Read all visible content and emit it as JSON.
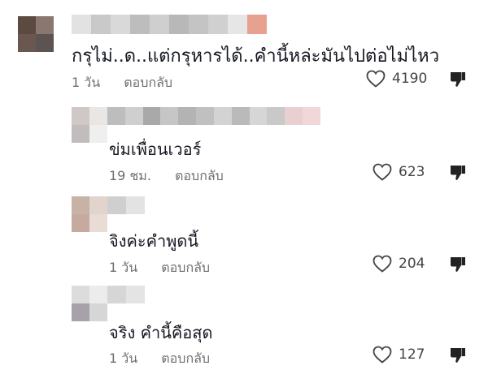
{
  "comments": [
    {
      "text": "กรุไม่..ด..แต่กรุหารได้..คำนี้หล่ะมันไปต่อไม่ไหว",
      "time": "1 วัน",
      "reply_label": "ตอบกลับ",
      "likes": "4190",
      "avatar_colors": [
        "#5a4a40",
        "#8a7870",
        "#6a5850",
        "#5c5452"
      ],
      "username_blocks": [
        "#e2e2e2",
        "#c9c9c9",
        "#d9d9d9",
        "#bdbdbd",
        "#cfcfcf",
        "#b8b8b8",
        "#c4c4c4",
        "#d0d0d0",
        "#e6e6e6",
        "#e8a090"
      ]
    },
    {
      "text": "ข่มเพื่อนเวอร์",
      "time": "19 ชม.",
      "reply_label": "ตอบกลับ",
      "likes": "623",
      "avatar_colors": [
        "#cfc8c6",
        "#e9e6e4",
        "#c2bdbd",
        "#efefef"
      ],
      "username_blocks": [
        "#bdbdbd",
        "#cfcfcf",
        "#a9a9a9",
        "#c6c6c6",
        "#b3b3b3",
        "#c0c0c0",
        "#d3d3d3",
        "#bababa",
        "#d6d6d6",
        "#c9c9c9",
        "#e8d0d0",
        "#f0d8d8"
      ]
    },
    {
      "text": "จิงค่ะคำพูดนี้",
      "time": "1 วัน",
      "reply_label": "ตอบกลับ",
      "likes": "204",
      "avatar_colors": [
        "#c8b2a6",
        "#e0d4cc",
        "#c6aaa0",
        "#e8dcd4"
      ],
      "username_blocks": [
        "#cfcfcf",
        "#e3e3e3"
      ]
    },
    {
      "text": "จริง คำนี้คือสุด",
      "time": "1 วัน",
      "reply_label": "ตอบกลับ",
      "likes": "127",
      "avatar_colors": [
        "#dcdcdc",
        "#ececec",
        "#a7a2aa",
        "#d6d6d6"
      ],
      "username_blocks": [
        "#d6d6d6",
        "#e4e4e4"
      ]
    }
  ]
}
